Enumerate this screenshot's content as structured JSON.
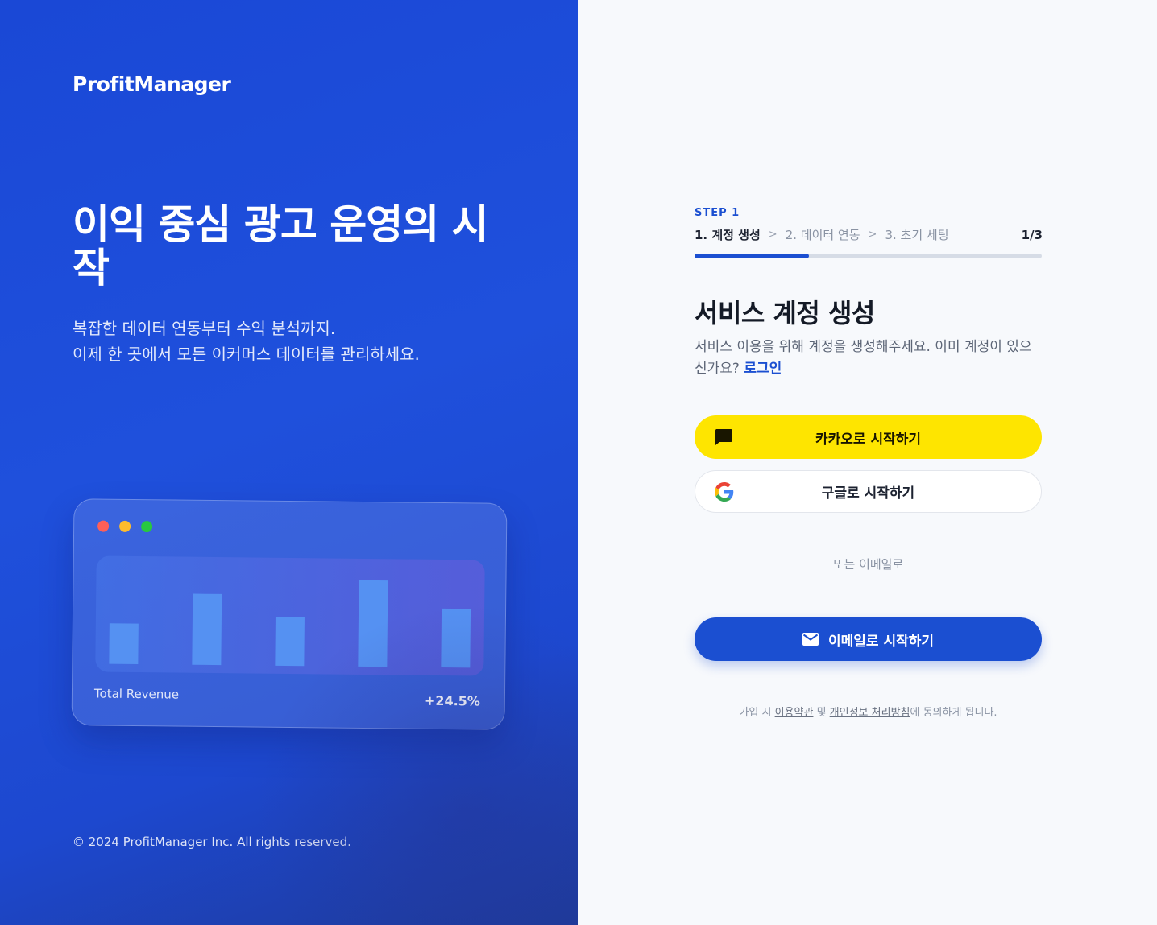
{
  "brand": "ProfitManager",
  "hero": {
    "title": "이익 중심 광고 운영의 시작",
    "sub_line1": "복잡한 데이터 연동부터 수익 분석까지.",
    "sub_line2": "이제 한 곳에서 모든 이커머스 데이터를 관리하세요."
  },
  "card": {
    "dot_colors": [
      "#ff5f57",
      "#febc2e",
      "#28c840"
    ],
    "label": "Total Revenue",
    "value": "+24.5%",
    "chart_data": {
      "type": "bar",
      "values": [
        40,
        70,
        48,
        85,
        58
      ],
      "ylim": [
        0,
        100
      ],
      "bar_color": "#5591f2"
    }
  },
  "footer": {
    "copyright": "© 2024 ProfitManager Inc. All rights reserved."
  },
  "signup": {
    "step_label": "STEP 1",
    "steps": [
      "1. 계정 생성",
      "2. 데이터 연동",
      "3. 초기 세팅"
    ],
    "step_sep": ">",
    "step_count": "1/3",
    "progress": 0.33,
    "title": "서비스 계정 생성",
    "desc": "서비스 이용을 위해 계정을 생성해주세요. 이미 계정이 있으신가요?",
    "login_link": "로그인",
    "kakao_button": "카카오로 시작하기",
    "google_button": "구글로 시작하기",
    "divider": "또는 이메일로",
    "email_button": "이메일로 시작하기",
    "terms_prefix": "가입 시 ",
    "terms_link": "이용약관",
    "terms_mid": " 및 ",
    "privacy_link": "개인정보 처리방침",
    "terms_suffix": "에 동의하게 됩니다.",
    "colors": {
      "primary": "#1b4fd1",
      "kakao": "#fee500"
    }
  }
}
